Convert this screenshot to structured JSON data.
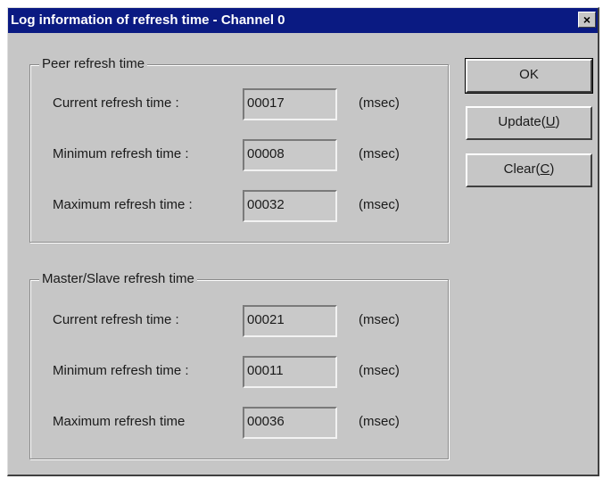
{
  "window": {
    "title": "Log information of refresh time - Channel 0",
    "close_glyph": "×"
  },
  "peer_group": {
    "title": "Peer refresh time",
    "rows": [
      {
        "label": "Current refresh time :",
        "value": "00017",
        "unit": "(msec)"
      },
      {
        "label": "Minimum refresh time :",
        "value": "00008",
        "unit": "(msec)"
      },
      {
        "label": "Maximum refresh time :",
        "value": "00032",
        "unit": "(msec)"
      }
    ]
  },
  "master_slave_group": {
    "title": "Master/Slave refresh time",
    "rows": [
      {
        "label": "Current refresh time :",
        "value": "00021",
        "unit": "(msec)"
      },
      {
        "label": "Minimum refresh time :",
        "value": "00011",
        "unit": "(msec)"
      },
      {
        "label": "Maximum refresh time",
        "value": "00036",
        "unit": "(msec)"
      }
    ]
  },
  "buttons": {
    "ok": "OK",
    "update_main": "Update(",
    "update_key": "U",
    "update_end": ")",
    "clear_main": "Clear(",
    "clear_key": "C",
    "clear_end": ")"
  },
  "colors": {
    "titlebar": "#0a1a82",
    "face": "#c6c6c6"
  }
}
